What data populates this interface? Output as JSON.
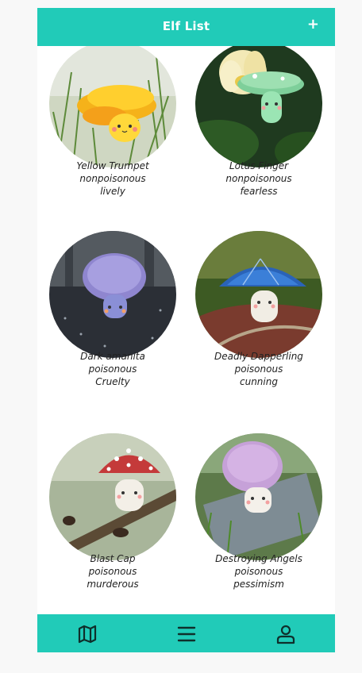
{
  "header": {
    "title": "Elf List",
    "add_label": "+"
  },
  "elves": [
    {
      "name": "Yellow Trumpet",
      "toxicity": "nonpoisonous",
      "trait": "lively"
    },
    {
      "name": "Lotus Finger",
      "toxicity": "nonpoisonous",
      "trait": "fearless"
    },
    {
      "name": "Dark amanita",
      "toxicity": "poisonous",
      "trait": "Cruelty"
    },
    {
      "name": "Deadly Dapperling",
      "toxicity": "poisonous",
      "trait": "cunning"
    },
    {
      "name": "Blast Cap",
      "toxicity": "poisonous",
      "trait": "murderous"
    },
    {
      "name": "Destroying Angels",
      "toxicity": "poisonous",
      "trait": "pessimism"
    }
  ],
  "navbar": {
    "icons": [
      "map-icon",
      "menu-icon",
      "user-icon"
    ]
  },
  "colors": {
    "accent": "#21cbb8"
  }
}
